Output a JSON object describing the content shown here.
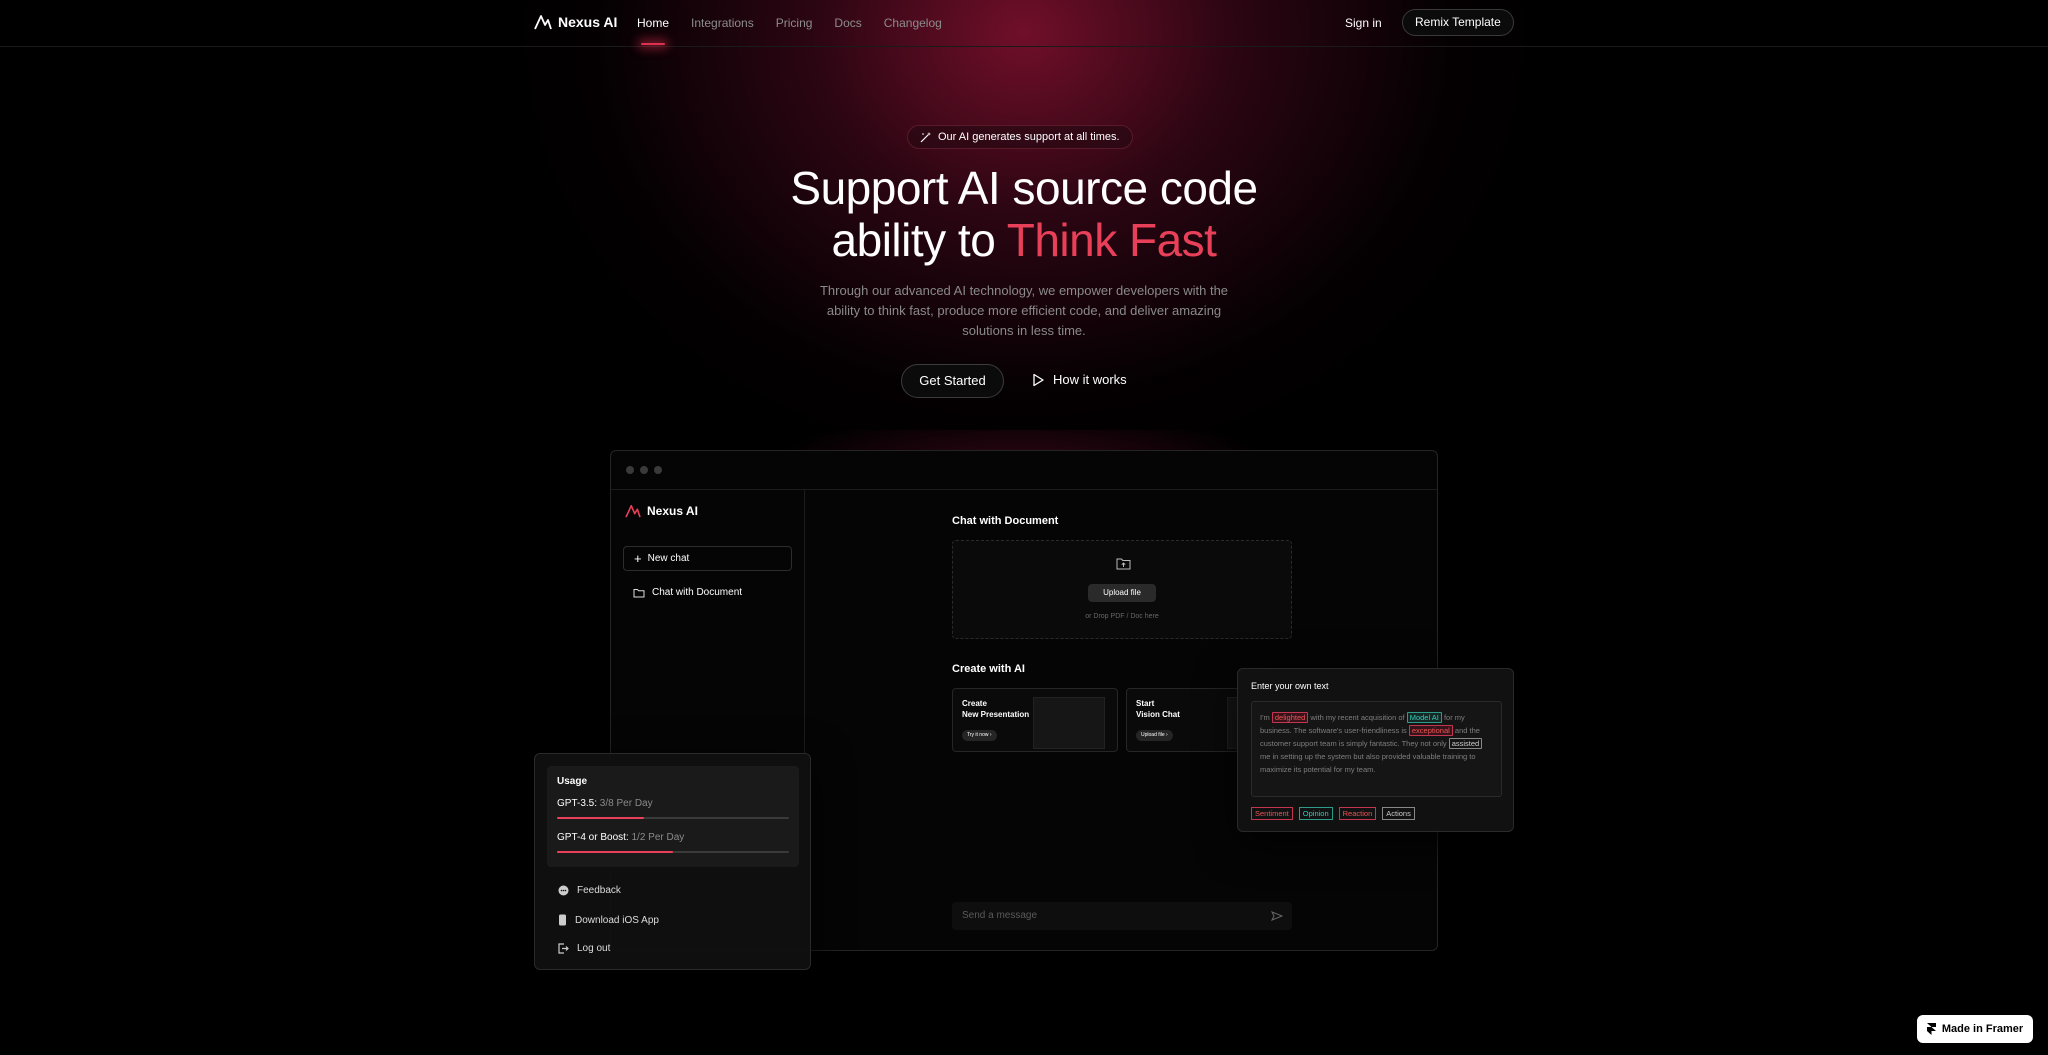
{
  "nav": {
    "brand": "Nexus AI",
    "links": [
      "Home",
      "Integrations",
      "Pricing",
      "Docs",
      "Changelog"
    ],
    "sign_in": "Sign in",
    "remix": "Remix Template"
  },
  "hero": {
    "badge": "Our AI generates support at all times.",
    "title_line1": "Support AI source code",
    "title_line2_prefix": "ability to ",
    "title_accent": "Think Fast",
    "subtitle": "Through our advanced AI technology, we empower developers with the ability to think fast, produce more efficient code, and deliver amazing solutions in less time.",
    "cta_primary": "Get Started",
    "cta_secondary": "How it works"
  },
  "app": {
    "brand": "Nexus AI",
    "new_chat": "New chat",
    "sidebar_item": "Chat with Document",
    "doc_title": "Chat with Document",
    "upload_button": "Upload file",
    "upload_hint": "or Drop PDF / Doc here",
    "create_title": "Create with AI",
    "card1_line1": "Create",
    "card1_line2": "New Presentation",
    "card1_button": "Try it now",
    "card2_line1": "Start",
    "card2_line2": "Vision Chat",
    "card2_button": "Upload file",
    "send_placeholder": "Send a message"
  },
  "usage": {
    "title": "Usage",
    "gpt35_label": "GPT-3.5:",
    "gpt35_value": "3/8 Per Day",
    "gpt35_fraction": 0.375,
    "gpt4_label": "GPT-4 or Boost:",
    "gpt4_value": "1/2 Per Day",
    "gpt4_fraction": 0.5,
    "menu": [
      "Feedback",
      "Download iOS App",
      "Log out"
    ]
  },
  "text_panel": {
    "title": "Enter your own text",
    "p1": "I'm ",
    "w1": "delighted",
    "p2": " with my recent acquisition of ",
    "w2": "Model AI",
    "p3": " for my business. The software's user-friendliness is ",
    "w3": "exceptional",
    "p4": " and the customer support team is simply fantastic. They not only ",
    "w4": "assisted",
    "p5": " me in setting up the system but also provided valuable training to maximize its potential for my team.",
    "tags": [
      "Sentiment",
      "Opinion",
      "Reaction",
      "Actions"
    ]
  },
  "framer": {
    "label": "Made in Framer"
  },
  "colors": {
    "accent": "#e9405a",
    "background": "#000000",
    "teal": "#33bbaa"
  }
}
